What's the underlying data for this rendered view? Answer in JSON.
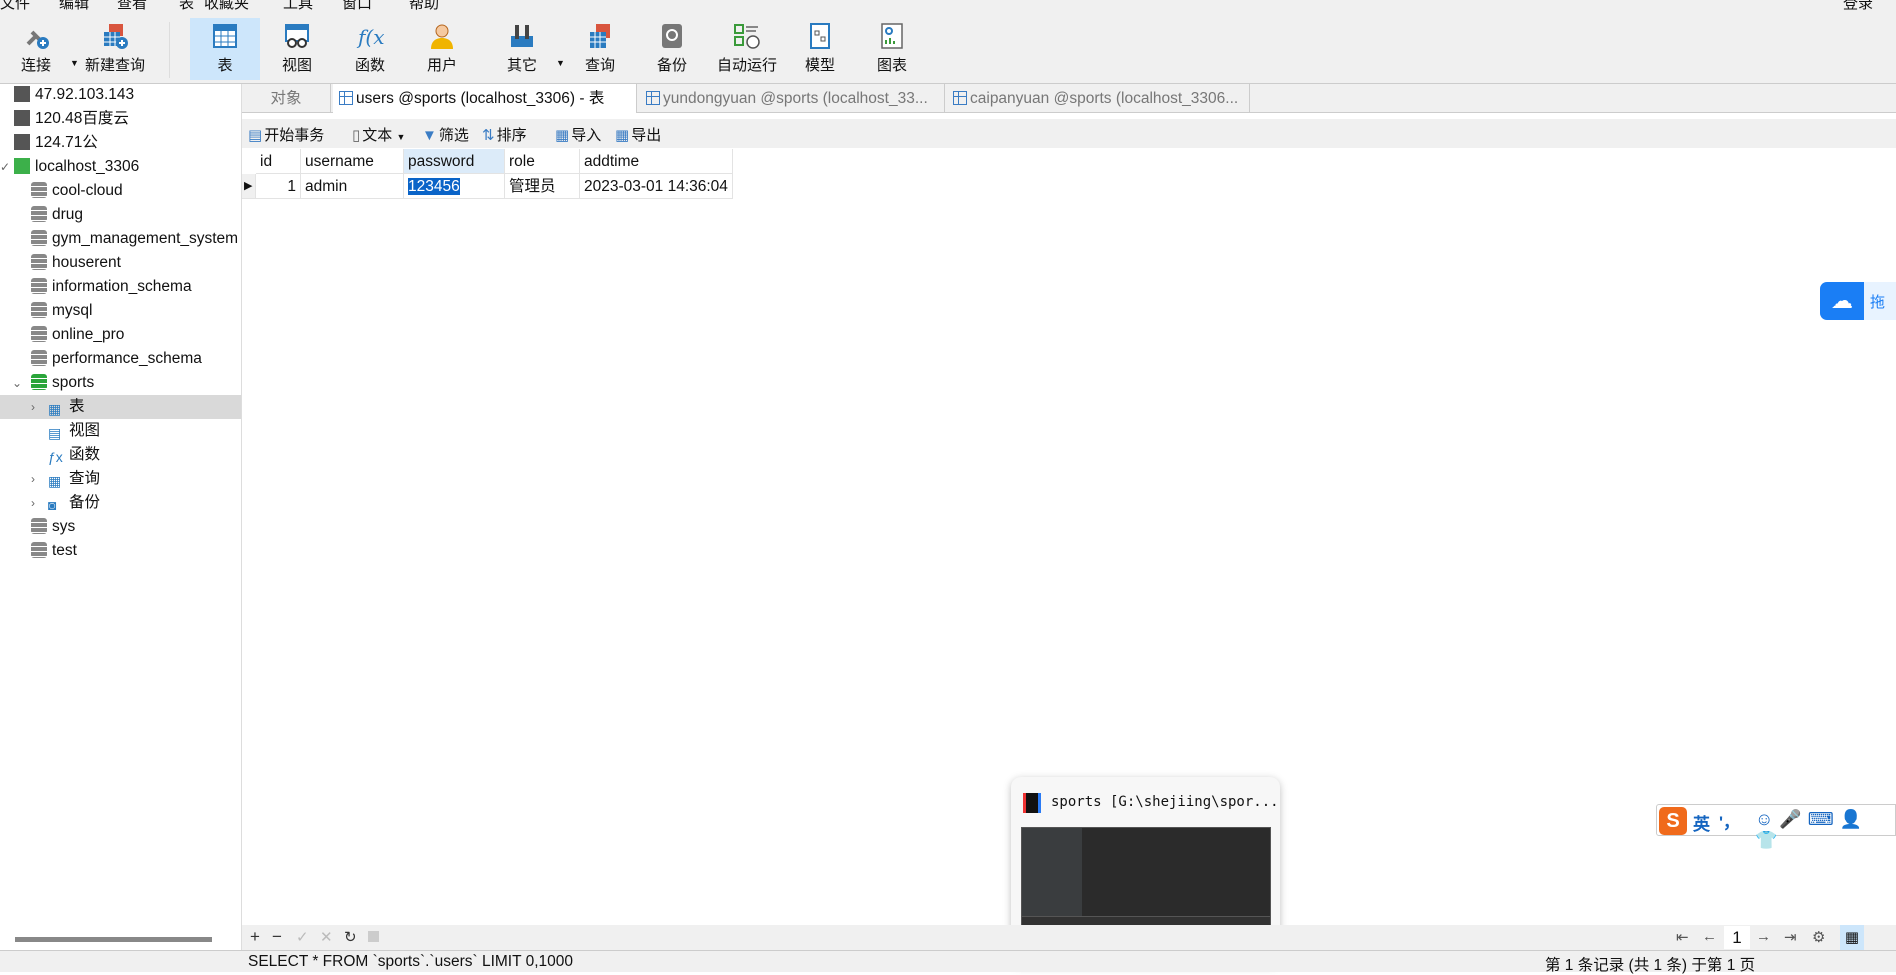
{
  "menu": [
    "文件",
    "编辑",
    "查看",
    "表",
    "收藏夹",
    "工具",
    "窗口",
    "帮助"
  ],
  "login": "登录",
  "toolbar": [
    {
      "id": "connect",
      "label": "连接"
    },
    {
      "id": "new-query",
      "label": "新建查询"
    },
    {
      "id": "table",
      "label": "表"
    },
    {
      "id": "view",
      "label": "视图"
    },
    {
      "id": "function",
      "label": "函数"
    },
    {
      "id": "user",
      "label": "用户"
    },
    {
      "id": "other",
      "label": "其它"
    },
    {
      "id": "query",
      "label": "查询"
    },
    {
      "id": "backup",
      "label": "备份"
    },
    {
      "id": "auto-run",
      "label": "自动运行"
    },
    {
      "id": "model",
      "label": "模型"
    },
    {
      "id": "chart",
      "label": "图表"
    }
  ],
  "sidebar": {
    "connections": [
      "47.92.103.143",
      "120.48百度云",
      "124.71公",
      "localhost_3306"
    ],
    "databases": [
      "cool-cloud",
      "drug",
      "gym_management_system",
      "houserent",
      "information_schema",
      "mysql",
      "online_pro",
      "performance_schema",
      "sports"
    ],
    "sports_children": [
      "表",
      "视图",
      "函数",
      "查询",
      "备份"
    ],
    "databases_after": [
      "sys",
      "test"
    ]
  },
  "tabs": [
    "对象",
    "users @sports (localhost_3306) - 表",
    "yundongyuan @sports (localhost_33...",
    "caipanyuan @sports (localhost_3306..."
  ],
  "subtoolbar": {
    "begin": "开始事务",
    "text": "文本",
    "filter": "筛选",
    "sort": "排序",
    "import": "导入",
    "export": "导出"
  },
  "grid": {
    "columns": [
      "id",
      "username",
      "password",
      "role",
      "addtime"
    ],
    "rows": [
      [
        "1",
        "admin",
        "123456",
        "管理员",
        "2023-03-01 14:36:04"
      ]
    ]
  },
  "sql": "SELECT * FROM `sports`.`users` LIMIT 0,1000",
  "status": "第 1 条记录 (共 1 条) 于第 1 页",
  "page": "1",
  "popup": {
    "title": "sports [G:\\shejiing\\spor..."
  },
  "ime": {
    "lang": "英",
    "punct": "'，"
  },
  "baidu": {
    "label": "拖"
  }
}
